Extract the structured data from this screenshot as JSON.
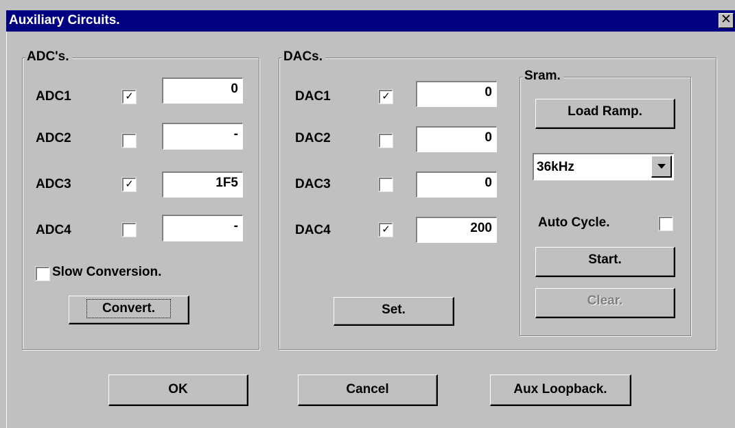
{
  "window": {
    "title": "Auxiliary Circuits.",
    "close_glyph": "✕"
  },
  "adc_group": {
    "title": "ADC's.",
    "rows": [
      {
        "label": "ADC1",
        "checked": true,
        "value": "0"
      },
      {
        "label": "ADC2",
        "checked": false,
        "value": "-"
      },
      {
        "label": "ADC3",
        "checked": true,
        "value": "1F5"
      },
      {
        "label": "ADC4",
        "checked": false,
        "value": "-"
      }
    ],
    "slow_conversion": {
      "label": "Slow Conversion.",
      "checked": false
    },
    "convert_label": "Convert."
  },
  "dac_group": {
    "title": "DACs.",
    "rows": [
      {
        "label": "DAC1",
        "checked": true,
        "value": "0"
      },
      {
        "label": "DAC2",
        "checked": false,
        "value": "0"
      },
      {
        "label": "DAC3",
        "checked": false,
        "value": "0"
      },
      {
        "label": "DAC4",
        "checked": true,
        "value": "200"
      }
    ],
    "set_label": "Set."
  },
  "sram_group": {
    "title": "Sram.",
    "load_ramp_label": "Load Ramp.",
    "frequency": "36kHz",
    "auto_cycle": {
      "label": "Auto Cycle.",
      "checked": false
    },
    "start_label": "Start.",
    "clear_label": "Clear."
  },
  "footer": {
    "ok_label": "OK",
    "cancel_label": "Cancel",
    "aux_loopback_label": "Aux Loopback."
  },
  "check_glyph": "✓",
  "colors": {
    "title_bar": "#000080",
    "face": "#c0c0c0",
    "disabled_text": "#808080"
  }
}
